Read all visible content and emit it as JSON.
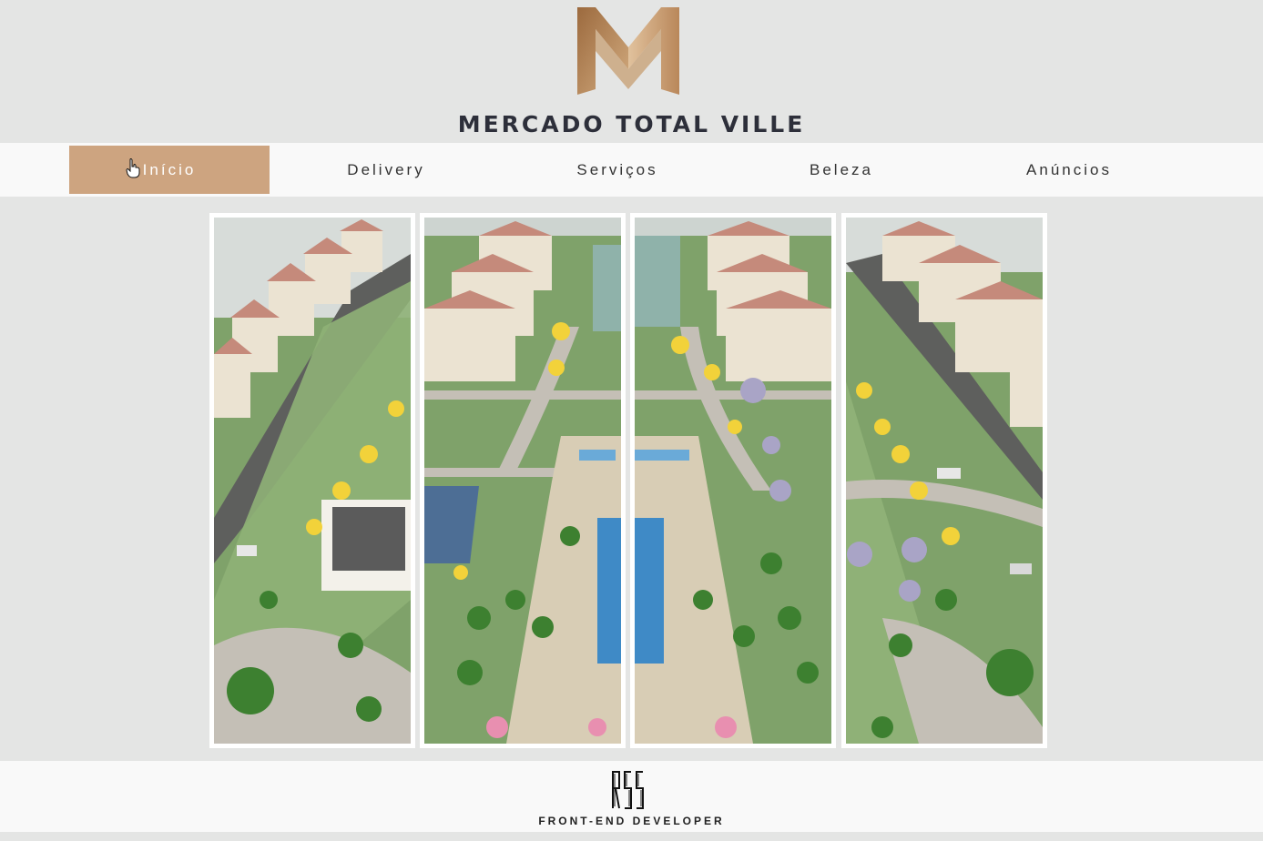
{
  "header": {
    "brand_name": "MERCADO TOTAL VILLE",
    "logo_icon": "mtv-monogram-icon"
  },
  "nav": {
    "items": [
      {
        "label": "Início",
        "active": true
      },
      {
        "label": "Delivery",
        "active": false
      },
      {
        "label": "Serviços",
        "active": false
      },
      {
        "label": "Beleza",
        "active": false
      },
      {
        "label": "Anúncios",
        "active": false
      }
    ]
  },
  "gallery": {
    "panels": [
      "aerial-view-left",
      "aerial-view-center-left",
      "aerial-view-center-right",
      "aerial-view-right"
    ]
  },
  "footer": {
    "monogram": "RSS",
    "tagline": "FRONT-END DEVELOPER"
  },
  "colors": {
    "background": "#e4e5e4",
    "accent": "#cda480",
    "bar": "#f9f9f9",
    "text_dark": "#2d2f3a"
  }
}
